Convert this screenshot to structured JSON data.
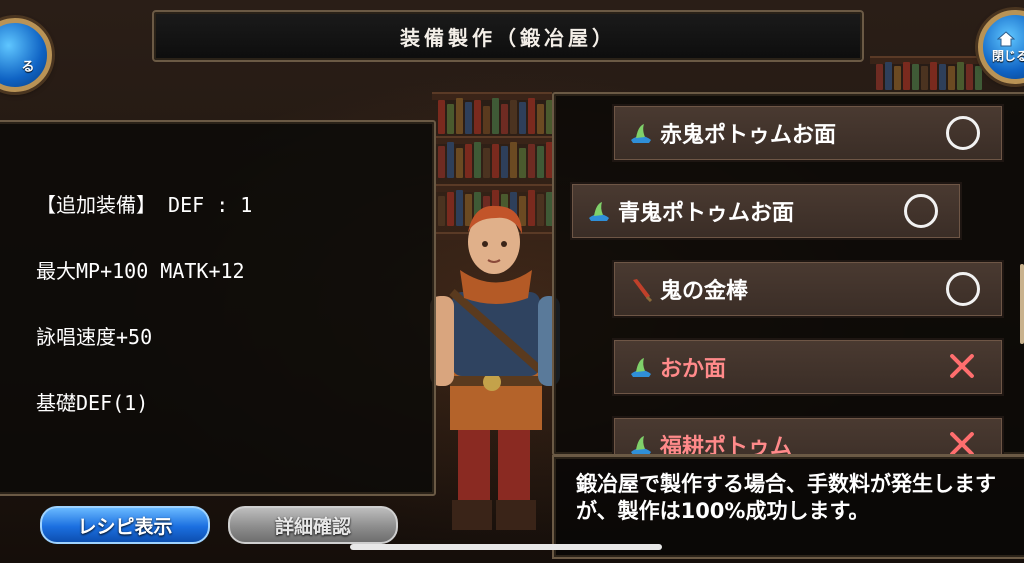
{
  "title": "装備製作（鍛冶屋）",
  "header": {
    "back_label": "る",
    "close_label": "閉じる"
  },
  "stats": {
    "lines": [
      "【追加装備】 DEF : 1",
      "最大MP+100 MATK+12",
      "詠唱速度+50",
      "基礎DEF(1)"
    ]
  },
  "recipes": [
    {
      "name": "赤鬼ポトゥムお面",
      "icon": "hat-icon",
      "status": "available"
    },
    {
      "name": "青鬼ポトゥムお面",
      "icon": "hat-icon",
      "status": "available"
    },
    {
      "name": "鬼の金棒",
      "icon": "club-icon",
      "status": "available"
    },
    {
      "name": "おか面",
      "icon": "hat-icon",
      "status": "unavailable"
    },
    {
      "name": "福耕ポトゥム",
      "icon": "hat-icon",
      "status": "unavailable"
    }
  ],
  "message": "鍛冶屋で製作する場合、手数料が発生しますが、製作は100%成功します。",
  "buttons": {
    "recipe_display": "レシピ表示",
    "detail_confirm": "詳細確認"
  },
  "colors": {
    "accent_blue": "#1b6fe0",
    "unavailable_red": "#ff6e6e",
    "frame_gold": "#6b5a45"
  }
}
